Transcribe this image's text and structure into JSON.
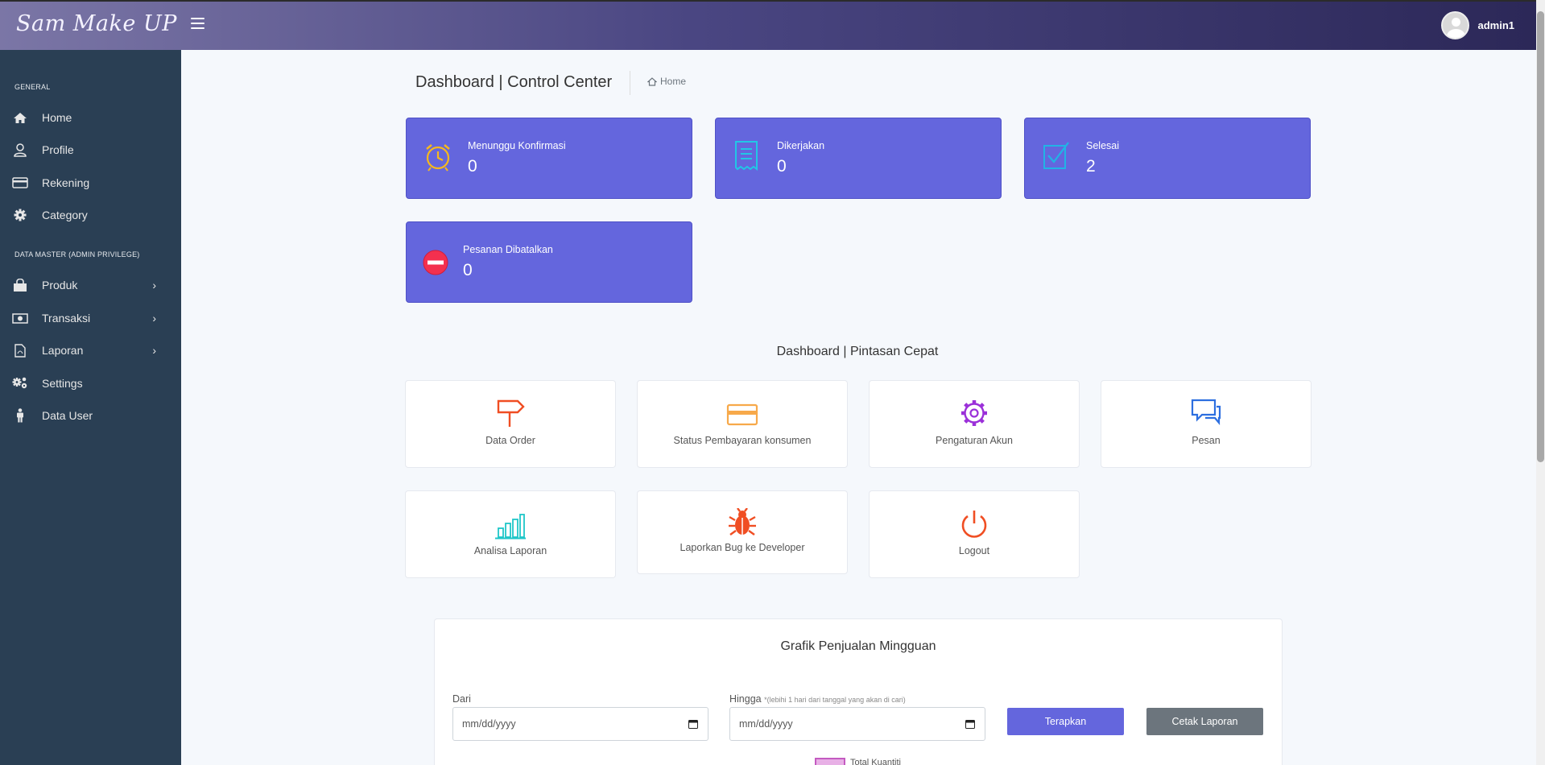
{
  "header": {
    "logo": "Sam Make UP",
    "username": "admin1"
  },
  "sidebar": {
    "sections": [
      "GENERAL",
      "DATA MASTER (ADMIN PRIVILEGE)"
    ],
    "items": [
      {
        "label": "Home",
        "icon": "home-icon"
      },
      {
        "label": "Profile",
        "icon": "user-icon"
      },
      {
        "label": "Rekening",
        "icon": "credit-card-icon"
      },
      {
        "label": "Category",
        "icon": "gear-icon"
      },
      {
        "label": "Produk",
        "icon": "shopping-bag-icon",
        "has_submenu": true
      },
      {
        "label": "Transaksi",
        "icon": "money-icon",
        "has_submenu": true
      },
      {
        "label": "Laporan",
        "icon": "pdf-file-icon",
        "has_submenu": true
      },
      {
        "label": "Settings",
        "icon": "gears-icon"
      },
      {
        "label": "Data User",
        "icon": "person-icon"
      }
    ]
  },
  "page": {
    "title": "Dashboard | Control Center",
    "breadcrumb": "Home"
  },
  "stats": [
    {
      "label": "Menunggu Konfirmasi",
      "value": "0",
      "icon": "alarm-clock-icon"
    },
    {
      "label": "Dikerjakan",
      "value": "0",
      "icon": "receipt-icon"
    },
    {
      "label": "Selesai",
      "value": "2",
      "icon": "checkbox-icon"
    },
    {
      "label": "Pesanan Dibatalkan",
      "value": "0",
      "icon": "cancel-icon"
    }
  ],
  "shortcuts_title": "Dashboard | Pintasan Cepat",
  "shortcuts": [
    {
      "label": "Data Order",
      "icon": "signpost-icon",
      "color": "#f04e23"
    },
    {
      "label": "Status Pembayaran konsumen",
      "icon": "credit-card-icon",
      "color": "#f7a94a"
    },
    {
      "label": "Pengaturan Akun",
      "icon": "gear-icon",
      "color": "#9b30d9"
    },
    {
      "label": "Pesan",
      "icon": "chat-icon",
      "color": "#2d6fe0"
    },
    {
      "label": "Analisa Laporan",
      "icon": "bar-chart-icon",
      "color": "#1fc6c8"
    },
    {
      "label": "Laporkan Bug ke Developer",
      "icon": "bug-icon",
      "color": "#f04e23"
    },
    {
      "label": "Logout",
      "icon": "power-icon",
      "color": "#f04e23"
    }
  ],
  "sales": {
    "title": "Grafik Penjualan Mingguan",
    "from_label": "Dari",
    "to_label": "Hingga",
    "to_hint": "*(lebihi 1 hari dari tanggal yang akan di cari)",
    "from_placeholder": "mm/dd/yyyy",
    "to_placeholder": "mm/dd/yyyy",
    "apply_label": "Terapkan",
    "print_label": "Cetak Laporan",
    "legend_label": "Total Kuantiti"
  },
  "colors": {
    "accent": "#6466dd",
    "sidebar": "#2a3f54",
    "secondary_button": "#6c757d"
  }
}
